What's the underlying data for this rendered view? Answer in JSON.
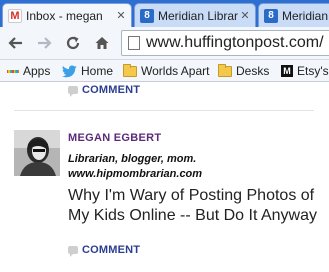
{
  "tabs": [
    {
      "title": "Inbox - megan",
      "favicon": "gmail-icon",
      "favicon_glyph": "M"
    },
    {
      "title": "Meridian Librar",
      "favicon": "meridian-icon",
      "favicon_glyph": "8"
    },
    {
      "title": "Meridian Lib",
      "favicon": "meridian-icon",
      "favicon_glyph": "8"
    }
  ],
  "toolbar": {
    "url": "www.huffingtonpost.com/"
  },
  "bookmarks": [
    {
      "label": "Apps",
      "icon": "apps-icon"
    },
    {
      "label": "Home",
      "icon": "twitter-icon"
    },
    {
      "label": "Worlds Apart",
      "icon": "folder-icon"
    },
    {
      "label": "Desks",
      "icon": "folder-icon"
    },
    {
      "label": "Etsy's",
      "icon": "etsy-icon",
      "icon_glyph": "M"
    }
  ],
  "content": {
    "top_comment_label": "COMMENT",
    "author": {
      "name": "MEGAN EGBERT",
      "bio_line1": "Librarian, blogger, mom.",
      "bio_line2": "www.hipmombrarian.com"
    },
    "headline": "Why I'm Wary of Posting Photos of My Kids Online -- But Do It Anyway",
    "bottom_comment_label": "COMMENT"
  },
  "colors": {
    "tabstrip": "#2f6fd1",
    "author_name": "#5b2b7a",
    "comment_link": "#2c3e8f"
  }
}
